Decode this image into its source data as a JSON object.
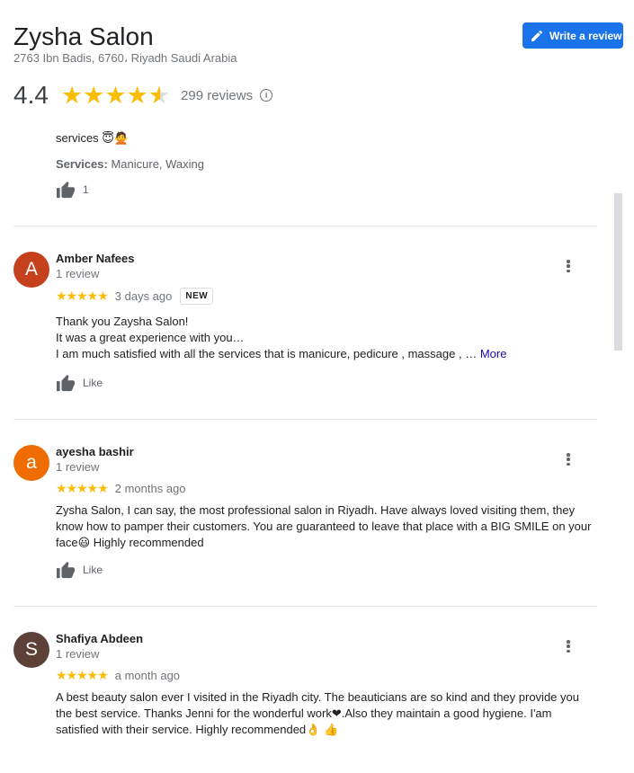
{
  "header": {
    "title": "Zysha Salon",
    "address": "2763 Ibn Badis, 6760، Riyadh Saudi Arabia",
    "write_review_label": "Write a review",
    "rating": "4.4",
    "rating_value": 4.4,
    "review_count": "299 reviews",
    "info_icon": "i"
  },
  "partial_review": {
    "text_end": "services 😇🙅",
    "services_label": "Services:",
    "services_value": "Manicure, Waxing",
    "like_count": "1"
  },
  "reviews": [
    {
      "initial": "A",
      "avatar_color": "#c5401d",
      "name": "Amber Nafees",
      "count": "1 review",
      "stars": "★★★★★",
      "date": "3 days ago",
      "badge": "NEW",
      "lines": [
        "Thank you Zaysha Salon!",
        "It was a great experience with you…",
        "I am much satisfied with all the services that is manicure, pedicure , massage , …"
      ],
      "more_label": "More",
      "like_label": "Like"
    },
    {
      "initial": "a",
      "avatar_color": "#ef6c00",
      "name": "ayesha bashir",
      "count": "1 review",
      "stars": "★★★★★",
      "date": "2 months ago",
      "text": "Zysha Salon, I can say, the most professional salon in Riyadh. Have always loved visiting them, they know how to pamper their customers. You are guaranteed to leave that place with a BIG SMILE on your face😃 Highly recommended",
      "like_label": "Like"
    },
    {
      "initial": "S",
      "avatar_color": "#5d4037",
      "name": "Shafiya Abdeen",
      "count": "1 review",
      "stars": "★★★★★",
      "date": "a month ago",
      "text": "A best beauty salon ever I visited in the Riyadh city. The beauticians are so kind and they provide you the best service. Thanks Jenni for the wonderful work❤.Also they maintain a good hygiene.  I'am satisfied with their service. Highly recommended👌 👍"
    }
  ],
  "colors": {
    "accent": "#1a73e8",
    "star": "#fbbc04",
    "more_link": "#1a0dab"
  },
  "icons": [
    "pencil-icon",
    "star-icon",
    "info-icon",
    "thumbs-up-icon",
    "more-vert-icon"
  ]
}
